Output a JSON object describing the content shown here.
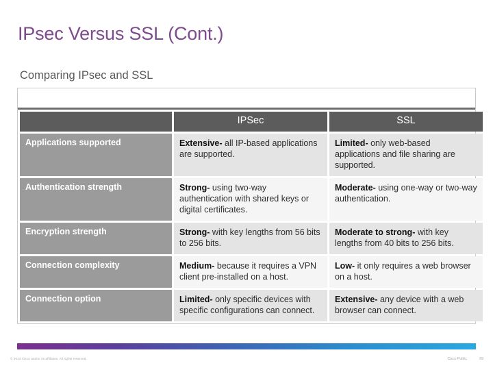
{
  "slide": {
    "title": "IPsec Versus SSL (Cont.)",
    "subtitle": "Comparing IPsec and SSL",
    "title_color": "#7e4b8e",
    "subtitle_color": "#58585b"
  },
  "table": {
    "headers": [
      "",
      "IPSec",
      "SSL"
    ],
    "header_bg": "#5c5c5c",
    "rowlabel_bg": "#9b9b9b",
    "rows": [
      {
        "label": "Applications supported",
        "ipsec_lead": "Extensive-",
        "ipsec_text": " all IP-based applications are supported.",
        "ssl_lead": "Limited-",
        "ssl_text": " only web-based applications and file sharing are supported."
      },
      {
        "label": "Authentication strength",
        "ipsec_lead": "Strong-",
        "ipsec_text": " using two-way authentication with shared keys or digital certificates.",
        "ssl_lead": "Moderate-",
        "ssl_text": " using one-way or two-way authentication."
      },
      {
        "label": "Encryption strength",
        "ipsec_lead": "Strong-",
        "ipsec_text": " with key lengths from 56 bits to 256 bits.",
        "ssl_lead": "Moderate to strong-",
        "ssl_text": " with key lengths from 40 bits to 256 bits."
      },
      {
        "label": "Connection complexity",
        "ipsec_lead": "Medium-",
        "ipsec_text": " because it requires a VPN client pre-installed on a host.",
        "ssl_lead": "Low-",
        "ssl_text": "  it only requires a web browser on a host."
      },
      {
        "label": "Connection option",
        "ipsec_lead": "Limited-",
        "ipsec_text": " only specific devices with specific configurations can connect.",
        "ssl_lead": "Extensive-",
        "ssl_text": "  any device with a web browser can connect."
      }
    ]
  },
  "footer": {
    "copyright": "© 2013 Cisco and/or its affiliates. All rights reserved.",
    "classification": "Cisco Public",
    "page_number": "69",
    "gradient_start": "#7b2f8e",
    "gradient_end": "#29a8e0"
  }
}
